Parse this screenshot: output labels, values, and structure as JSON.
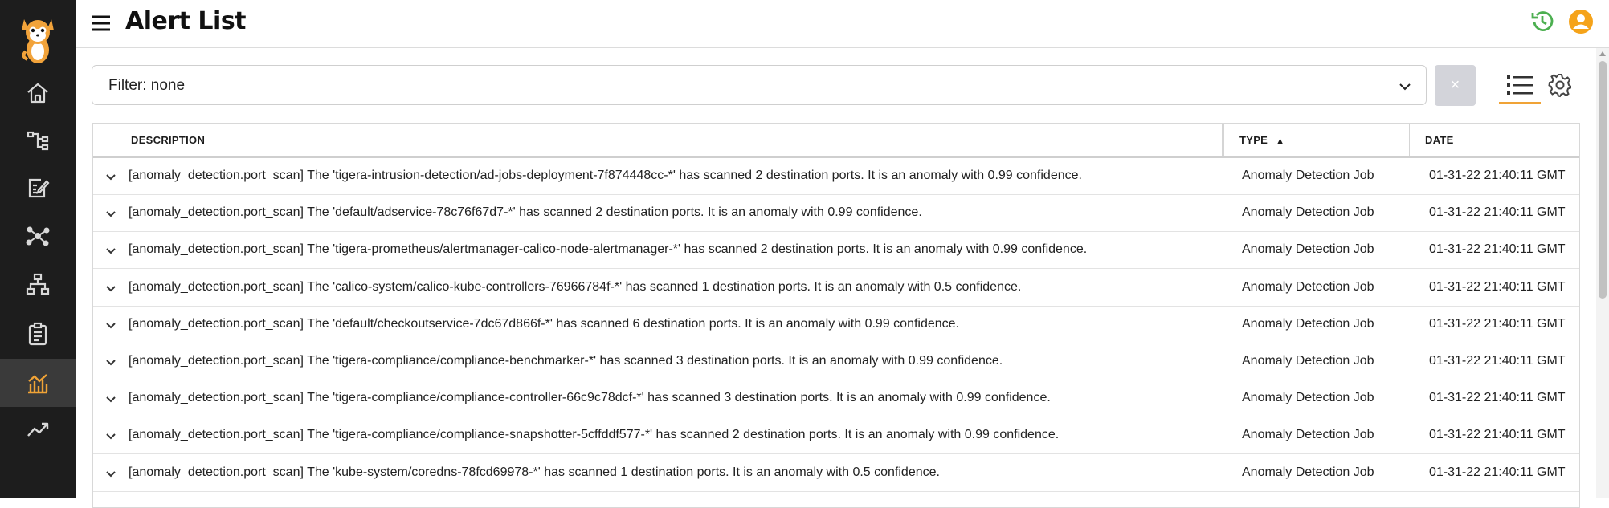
{
  "header": {
    "title": "Alert List"
  },
  "sidebar": {
    "items": [
      {
        "icon": "home-icon"
      },
      {
        "icon": "flow-graph-icon"
      },
      {
        "icon": "policy-edit-icon"
      },
      {
        "icon": "network-icon"
      },
      {
        "icon": "hierarchy-icon"
      },
      {
        "icon": "clipboard-icon"
      },
      {
        "icon": "alerts-chart-icon",
        "active": true
      },
      {
        "icon": "trending-up-icon"
      }
    ]
  },
  "filter": {
    "label": "Filter: none",
    "clear_label": "×"
  },
  "table": {
    "columns": [
      {
        "label": "DESCRIPTION"
      },
      {
        "label": "TYPE",
        "sort": "▲"
      },
      {
        "label": "DATE"
      }
    ],
    "rows": [
      {
        "description": "[anomaly_detection.port_scan] The 'tigera-intrusion-detection/ad-jobs-deployment-7f874448cc-*' has scanned 2 destination ports. It is an anomaly with 0.99 confidence.",
        "type": "Anomaly Detection Job",
        "date": "01-31-22 21:40:11 GMT"
      },
      {
        "description": "[anomaly_detection.port_scan] The 'default/adservice-78c76f67d7-*' has scanned 2 destination ports. It is an anomaly with 0.99 confidence.",
        "type": "Anomaly Detection Job",
        "date": "01-31-22 21:40:11 GMT"
      },
      {
        "description": "[anomaly_detection.port_scan] The 'tigera-prometheus/alertmanager-calico-node-alertmanager-*' has scanned 2 destination ports. It is an anomaly with 0.99 confidence.",
        "type": "Anomaly Detection Job",
        "date": "01-31-22 21:40:11 GMT"
      },
      {
        "description": "[anomaly_detection.port_scan] The 'calico-system/calico-kube-controllers-76966784f-*' has scanned 1 destination ports. It is an anomaly with 0.5 confidence.",
        "type": "Anomaly Detection Job",
        "date": "01-31-22 21:40:11 GMT"
      },
      {
        "description": "[anomaly_detection.port_scan] The 'default/checkoutservice-7dc67d866f-*' has scanned 6 destination ports. It is an anomaly with 0.99 confidence.",
        "type": "Anomaly Detection Job",
        "date": "01-31-22 21:40:11 GMT"
      },
      {
        "description": "[anomaly_detection.port_scan] The 'tigera-compliance/compliance-benchmarker-*' has scanned 3 destination ports. It is an anomaly with 0.99 confidence.",
        "type": "Anomaly Detection Job",
        "date": "01-31-22 21:40:11 GMT"
      },
      {
        "description": "[anomaly_detection.port_scan] The 'tigera-compliance/compliance-controller-66c9c78dcf-*' has scanned 3 destination ports. It is an anomaly with 0.99 confidence.",
        "type": "Anomaly Detection Job",
        "date": "01-31-22 21:40:11 GMT"
      },
      {
        "description": "[anomaly_detection.port_scan] The 'tigera-compliance/compliance-snapshotter-5cffddf577-*' has scanned 2 destination ports. It is an anomaly with 0.99 confidence.",
        "type": "Anomaly Detection Job",
        "date": "01-31-22 21:40:11 GMT"
      },
      {
        "description": "[anomaly_detection.port_scan] The 'kube-system/coredns-78fcd69978-*' has scanned 1 destination ports. It is an anomaly with 0.5 confidence.",
        "type": "Anomaly Detection Job",
        "date": "01-31-22 21:40:11 GMT"
      }
    ]
  },
  "colors": {
    "sidebar_bg": "#1d1d1d",
    "accent": "#f0a336",
    "history_icon": "#4caf50",
    "user_icon": "#f5a31a"
  }
}
